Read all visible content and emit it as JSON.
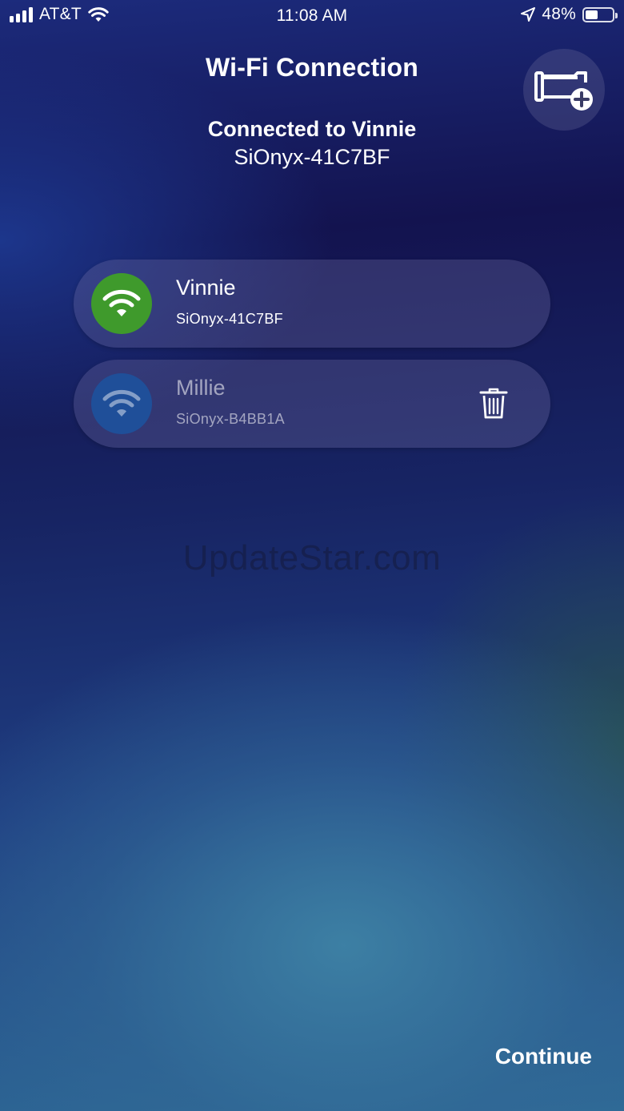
{
  "status_bar": {
    "carrier": "AT&T",
    "time": "11:08 AM",
    "battery_percent": "48%",
    "battery_level": 0.48,
    "signal_bars": 4,
    "icons": [
      "signal-icon",
      "wifi-icon",
      "location-arrow-icon",
      "battery-icon"
    ]
  },
  "header": {
    "title": "Wi-Fi Connection",
    "connected_label": "Connected to Vinnie",
    "connected_ssid": "SiOnyx-41C7BF",
    "add_button_icon": "add-camera-icon"
  },
  "networks": [
    {
      "name": "Vinnie",
      "ssid": "SiOnyx-41C7BF",
      "connected": true,
      "icon": "wifi-icon",
      "badge_color": "#3f9a2c"
    },
    {
      "name": "Millie",
      "ssid": "SiOnyx-B4BB1A",
      "connected": false,
      "icon": "wifi-icon",
      "badge_color": "#1f4f99",
      "action_icon": "trash-icon"
    }
  ],
  "watermark": "UpdateStar.com",
  "footer": {
    "continue_label": "Continue"
  }
}
